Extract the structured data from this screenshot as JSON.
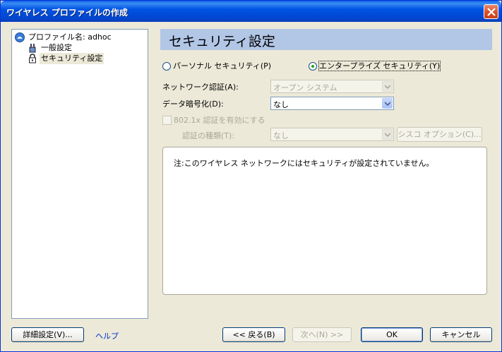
{
  "window": {
    "title": "ワイヤレス プロファイルの作成"
  },
  "tree": {
    "root_label": "プロファイル名: adhoc",
    "items": [
      {
        "label": "一般設定"
      },
      {
        "label": "セキュリティ設定",
        "selected": true
      }
    ]
  },
  "header": {
    "title": "セキュリティ設定"
  },
  "security_mode": {
    "personal_label": "パーソナル セキュリティ(P)",
    "enterprise_label": "エンタープライズ セキュリティ(Y)",
    "selected": "enterprise"
  },
  "form": {
    "network_auth_label": "ネットワーク認証(A):",
    "network_auth_value": "オープン システム",
    "data_encryption_label": "データ暗号化(D):",
    "data_encryption_value": "なし",
    "enable_8021x_label": "802.1x 認証を有効にする",
    "auth_type_label": "認証の種類(T):",
    "auth_type_value": "なし",
    "cisco_options_label": "シスコ オプション(C)..."
  },
  "note": {
    "text": "注:このワイヤレス ネットワークにはセキュリティが設定されていません。"
  },
  "footer": {
    "advanced_label": "詳細設定(V)...",
    "help_label": "ヘルプ",
    "back_label": "<< 戻る(B)",
    "next_label": "次へ(N) >>",
    "ok_label": "OK",
    "cancel_label": "キャンセル"
  },
  "colors": {
    "header_band": "#b2c6e6",
    "title_bar": "#0054e3",
    "selected_radio_dot": "#21a121"
  }
}
